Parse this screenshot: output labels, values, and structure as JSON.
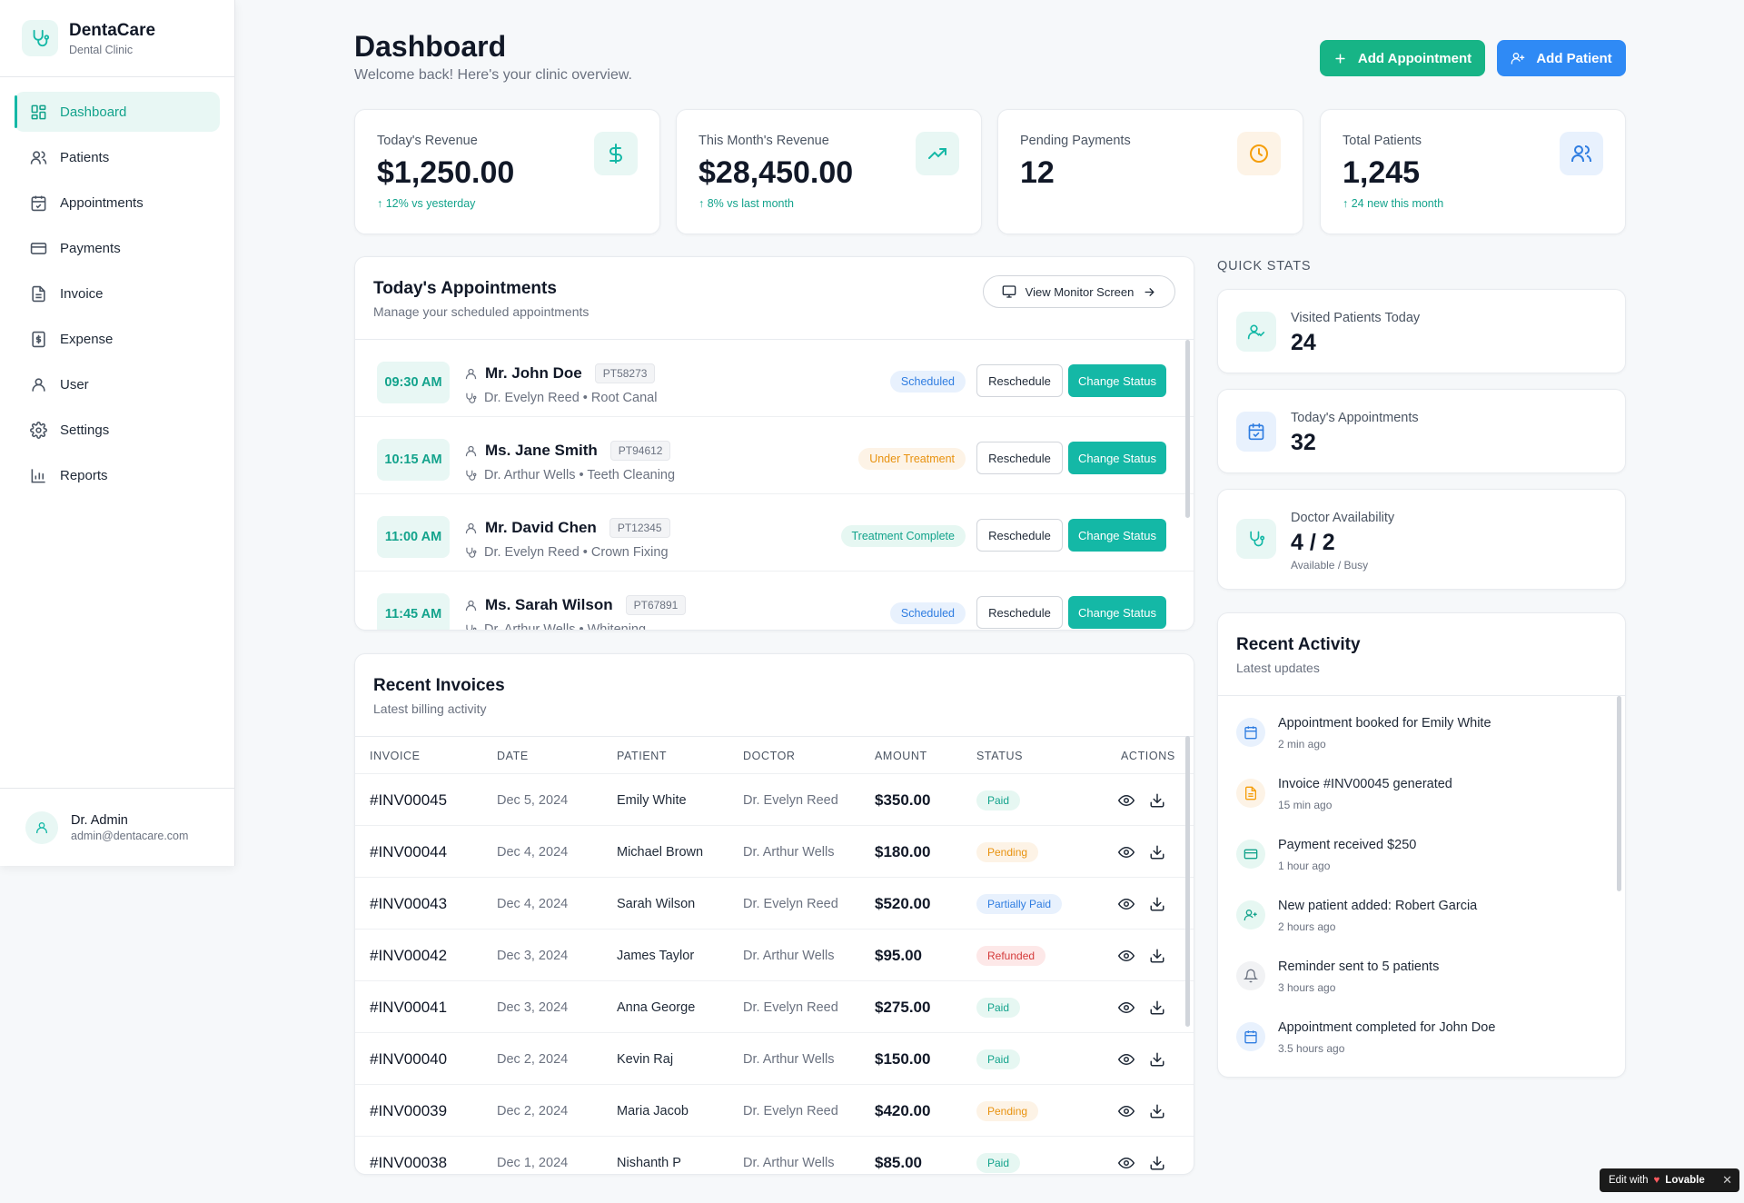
{
  "brand": {
    "name": "DentaCare",
    "subtitle": "Dental Clinic"
  },
  "sidebar": {
    "items": [
      {
        "label": "Dashboard",
        "icon": "dashboard-icon",
        "active": true
      },
      {
        "label": "Patients",
        "icon": "users-icon"
      },
      {
        "label": "Appointments",
        "icon": "calendar-check-icon"
      },
      {
        "label": "Payments",
        "icon": "credit-card-icon"
      },
      {
        "label": "Invoice",
        "icon": "file-text-icon"
      },
      {
        "label": "Expense",
        "icon": "receipt-icon"
      },
      {
        "label": "User",
        "icon": "user-icon"
      },
      {
        "label": "Settings",
        "icon": "gear-icon"
      },
      {
        "label": "Reports",
        "icon": "bar-chart-icon"
      }
    ],
    "user": {
      "name": "Dr. Admin",
      "email": "admin@dentacare.com"
    }
  },
  "header": {
    "title": "Dashboard",
    "subtitle": "Welcome back! Here's your clinic overview.",
    "add_appointment": "Add Appointment",
    "add_patient": "Add Patient"
  },
  "stats": [
    {
      "label": "Today's Revenue",
      "value": "$1,250.00",
      "trend": "12% vs yesterday",
      "icon": "dollar-icon"
    },
    {
      "label": "This Month's Revenue",
      "value": "$28,450.00",
      "trend": "8% vs last month",
      "icon": "trending-up-icon"
    },
    {
      "label": "Pending Payments",
      "value": "12",
      "trend": "",
      "icon": "clock-icon"
    },
    {
      "label": "Total Patients",
      "value": "1,245",
      "trend": "24 new this month",
      "icon": "users-icon"
    }
  ],
  "appointments": {
    "title": "Today's Appointments",
    "subtitle": "Manage your scheduled appointments",
    "monitor_button": "View Monitor Screen",
    "reschedule_label": "Reschedule",
    "change_status_label": "Change Status",
    "items": [
      {
        "time": "09:30 AM",
        "patient": "Mr. John Doe",
        "pid": "PT58273",
        "doctor": "Dr. Evelyn Reed • Root Canal",
        "status": "Scheduled"
      },
      {
        "time": "10:15 AM",
        "patient": "Ms. Jane Smith",
        "pid": "PT94612",
        "doctor": "Dr. Arthur Wells • Teeth Cleaning",
        "status": "Under Treatment"
      },
      {
        "time": "11:00 AM",
        "patient": "Mr. David Chen",
        "pid": "PT12345",
        "doctor": "Dr. Evelyn Reed • Crown Fixing",
        "status": "Treatment Complete"
      },
      {
        "time": "11:45 AM",
        "patient": "Ms. Sarah Wilson",
        "pid": "PT67891",
        "doctor": "Dr. Arthur Wells • Whitening",
        "status": "Scheduled"
      }
    ]
  },
  "invoices": {
    "title": "Recent Invoices",
    "subtitle": "Latest billing activity",
    "columns": [
      "INVOICE",
      "DATE",
      "PATIENT",
      "DOCTOR",
      "AMOUNT",
      "STATUS",
      "ACTIONS"
    ],
    "rows": [
      {
        "invoice": "#INV00045",
        "date": "Dec 5, 2024",
        "patient": "Emily White",
        "doctor": "Dr. Evelyn Reed",
        "amount": "$350.00",
        "status": "Paid"
      },
      {
        "invoice": "#INV00044",
        "date": "Dec 4, 2024",
        "patient": "Michael Brown",
        "doctor": "Dr. Arthur Wells",
        "amount": "$180.00",
        "status": "Pending"
      },
      {
        "invoice": "#INV00043",
        "date": "Dec 4, 2024",
        "patient": "Sarah Wilson",
        "doctor": "Dr. Evelyn Reed",
        "amount": "$520.00",
        "status": "Partially Paid"
      },
      {
        "invoice": "#INV00042",
        "date": "Dec 3, 2024",
        "patient": "James Taylor",
        "doctor": "Dr. Arthur Wells",
        "amount": "$95.00",
        "status": "Refunded"
      },
      {
        "invoice": "#INV00041",
        "date": "Dec 3, 2024",
        "patient": "Anna George",
        "doctor": "Dr. Evelyn Reed",
        "amount": "$275.00",
        "status": "Paid"
      },
      {
        "invoice": "#INV00040",
        "date": "Dec 2, 2024",
        "patient": "Kevin Raj",
        "doctor": "Dr. Arthur Wells",
        "amount": "$150.00",
        "status": "Paid"
      },
      {
        "invoice": "#INV00039",
        "date": "Dec 2, 2024",
        "patient": "Maria Jacob",
        "doctor": "Dr. Evelyn Reed",
        "amount": "$420.00",
        "status": "Pending"
      },
      {
        "invoice": "#INV00038",
        "date": "Dec 1, 2024",
        "patient": "Nishanth P",
        "doctor": "Dr. Arthur Wells",
        "amount": "$85.00",
        "status": "Paid"
      }
    ]
  },
  "quick_stats": {
    "label": "QUICK STATS",
    "items": [
      {
        "title": "Visited Patients Today",
        "value": "24",
        "sub": "",
        "icon": "user-check-icon"
      },
      {
        "title": "Today's Appointments",
        "value": "32",
        "sub": "",
        "icon": "calendar-check-icon"
      },
      {
        "title": "Doctor Availability",
        "value": "4 / 2",
        "sub": "Available / Busy",
        "icon": "stethoscope-icon"
      }
    ]
  },
  "activity": {
    "title": "Recent Activity",
    "subtitle": "Latest updates",
    "items": [
      {
        "text": "Appointment booked for Emily White",
        "time": "2 min ago",
        "icon": "calendar-icon"
      },
      {
        "text": "Invoice #INV00045 generated",
        "time": "15 min ago",
        "icon": "file-text-icon"
      },
      {
        "text": "Payment received $250",
        "time": "1 hour ago",
        "icon": "credit-card-icon"
      },
      {
        "text": "New patient added: Robert Garcia",
        "time": "2 hours ago",
        "icon": "user-plus-icon"
      },
      {
        "text": "Reminder sent to 5 patients",
        "time": "3 hours ago",
        "icon": "bell-icon"
      },
      {
        "text": "Appointment completed for John Doe",
        "time": "3.5 hours ago",
        "icon": "calendar-icon"
      }
    ]
  },
  "footer_badge": {
    "text": "Edit with",
    "brand": "Lovable"
  },
  "colors": {
    "accent": "#14b8a6",
    "primary_green": "#17b486",
    "primary_blue": "#2f8af5"
  }
}
